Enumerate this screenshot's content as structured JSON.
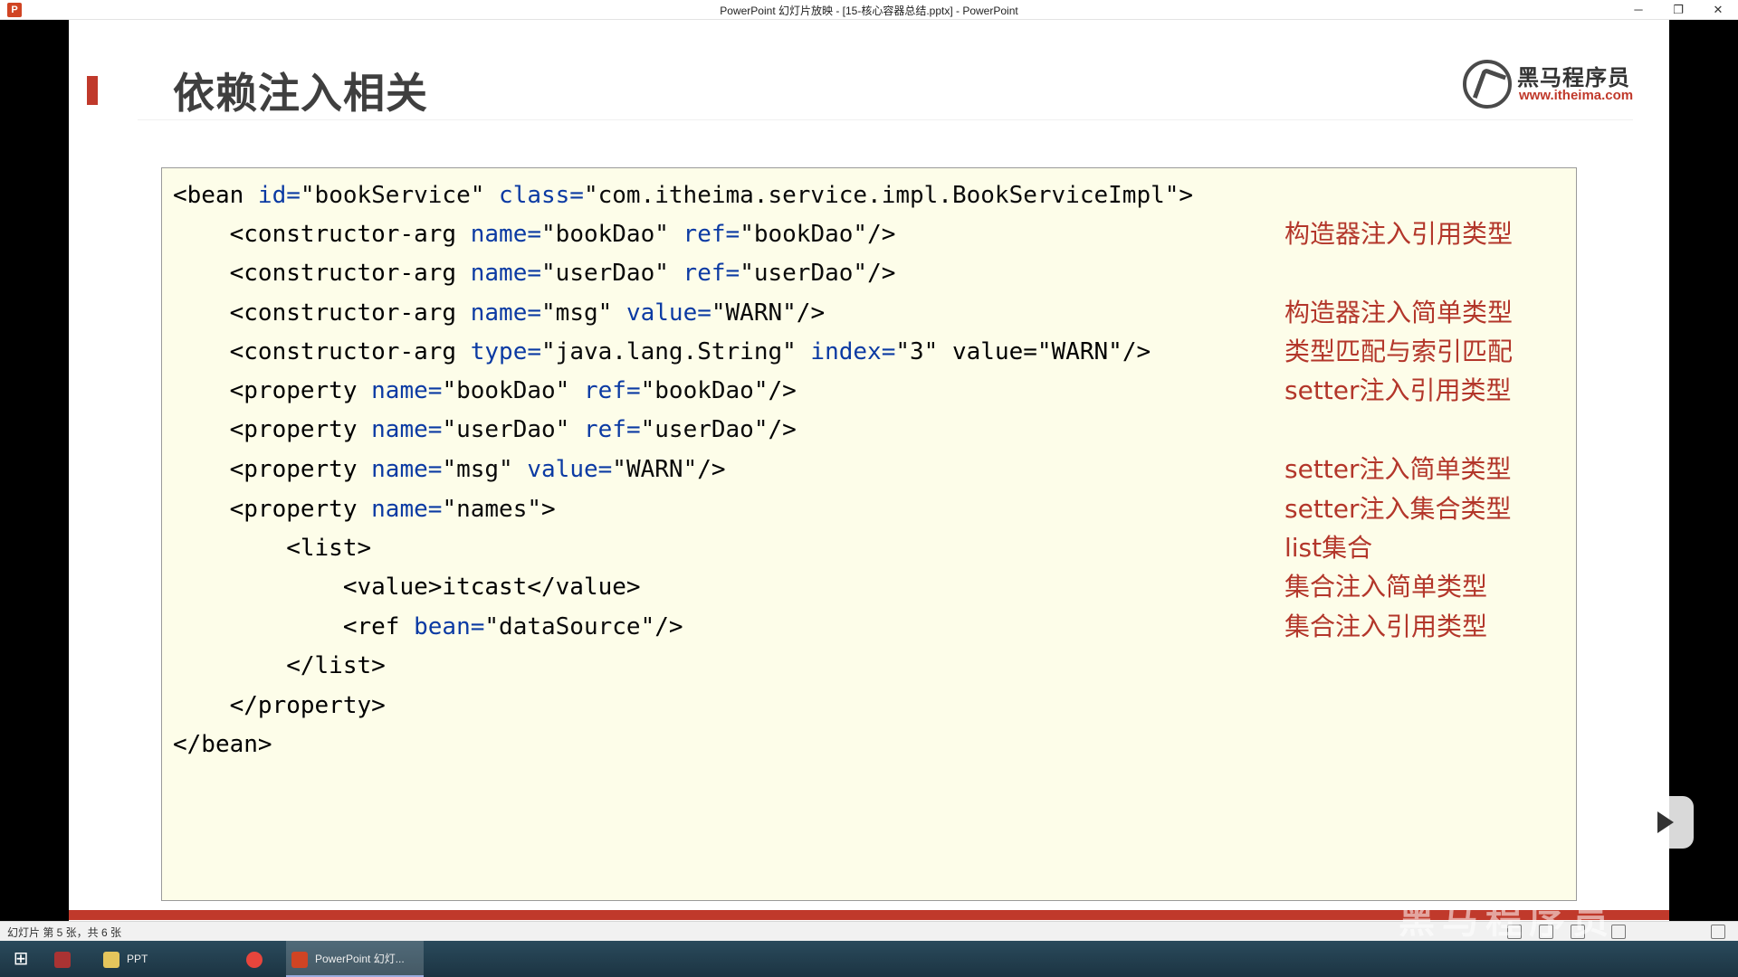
{
  "window": {
    "title": "PowerPoint 幻灯片放映 - [15-核心容器总结.pptx] - PowerPoint",
    "app_icon": "powerpoint-icon",
    "minimize": "─",
    "restore": "❐",
    "close": "✕"
  },
  "slide": {
    "heading": "依赖注入相关",
    "logo": {
      "name_cn": "黑马程序员",
      "url": "www.itheima.com"
    },
    "code": [
      [
        "<bean ",
        "id=",
        "\"bookService\"",
        " class=",
        "\"com.itheima.service.impl.BookServiceImpl\"",
        ">"
      ],
      [
        "    <constructor-arg ",
        "name=",
        "\"bookDao\"",
        " ref=",
        "\"bookDao\"",
        "/>"
      ],
      [
        "    <constructor-arg ",
        "name=",
        "\"userDao\"",
        " ref=",
        "\"userDao\"",
        "/>"
      ],
      [
        "    <constructor-arg ",
        "name=",
        "\"msg\"",
        " value=",
        "\"WARN\"",
        "/>"
      ],
      [
        "    <constructor-arg ",
        "type=",
        "\"java.lang.String\"",
        " index=",
        "\"3\"",
        " value=\"WARN\"/>"
      ],
      [
        "    <property ",
        "name=",
        "\"bookDao\"",
        " ref=",
        "\"bookDao\"",
        "/>"
      ],
      [
        "    <property ",
        "name=",
        "\"userDao\"",
        " ref=",
        "\"userDao\"",
        "/>"
      ],
      [
        "    <property ",
        "name=",
        "\"msg\"",
        " value=",
        "\"WARN\"",
        "/>"
      ],
      [
        "    <property ",
        "name=",
        "\"names\"",
        "",
        "",
        ">"
      ],
      [
        "        <list>",
        "",
        "",
        "",
        "",
        ""
      ],
      [
        "            <value>itcast</value>",
        "",
        "",
        "",
        "",
        ""
      ],
      [
        "            <ref ",
        "bean=",
        "\"dataSource\"",
        "",
        "",
        "/>"
      ],
      [
        "        </list>",
        "",
        "",
        "",
        "",
        ""
      ],
      [
        "    </property>",
        "",
        "",
        "",
        "",
        ""
      ],
      [
        "</bean>",
        "",
        "",
        "",
        "",
        ""
      ]
    ],
    "notes": {
      "n1": "构造器注入引用类型",
      "n3": "构造器注入简单类型",
      "n4": "类型匹配与索引匹配",
      "n5": "setter注入引用类型",
      "n7": "setter注入简单类型",
      "n8": "setter注入集合类型",
      "n9": "list集合",
      "n10": "集合注入简单类型",
      "n11": "集合注入引用类型"
    }
  },
  "status": {
    "slide_count": "幻灯片 第 5 张，共 6 张"
  },
  "taskbar": {
    "start_icon": "windows-start-icon",
    "items": {
      "ppt_folder": "PPT",
      "powerpoint": "PowerPoint 幻灯..."
    }
  },
  "overlay": {
    "watermark": "黑马程序员"
  },
  "colors": {
    "accent_red": "#c0392b",
    "code_bg": "#fdfde9",
    "attr_blue": "#0b3aa3",
    "note_red": "#b3362a"
  }
}
